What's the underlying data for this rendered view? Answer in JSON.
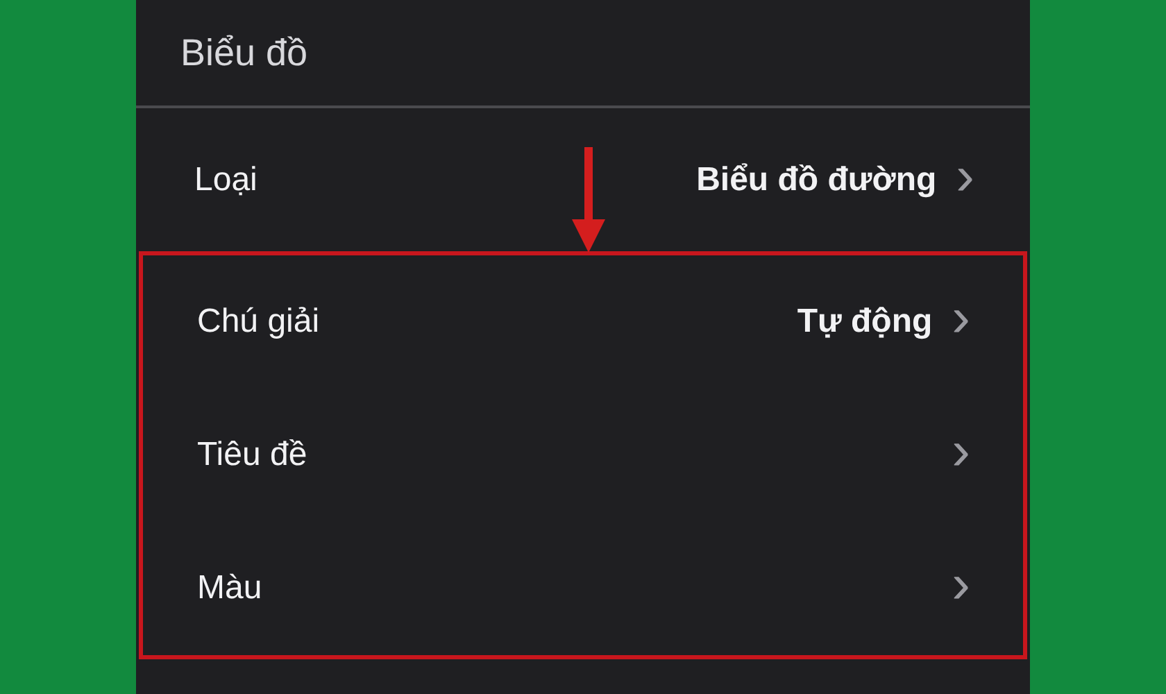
{
  "header": {
    "title": "Biểu đồ"
  },
  "rows": [
    {
      "label": "Loại",
      "value": "Biểu đồ đường",
      "highlighted": false
    },
    {
      "label": "Chú giải",
      "value": "Tự động",
      "highlighted": true
    },
    {
      "label": "Tiêu đề",
      "highlighted": true
    },
    {
      "label": "Màu",
      "highlighted": true
    }
  ],
  "chevron": "›"
}
